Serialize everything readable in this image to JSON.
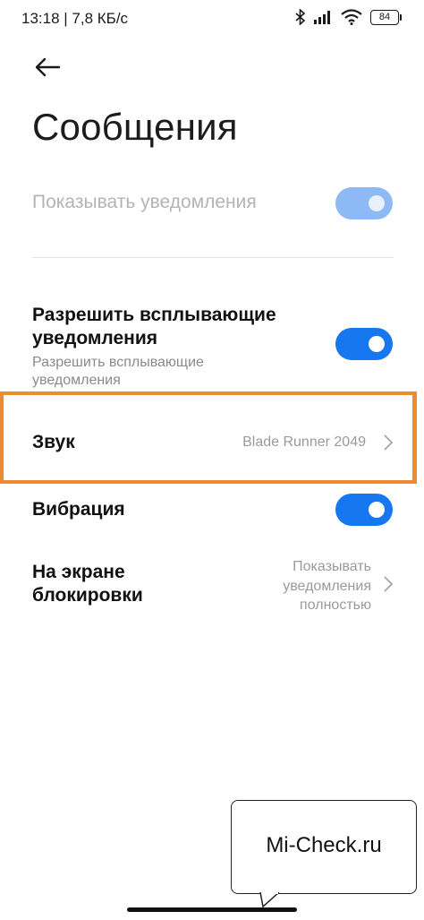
{
  "status_bar": {
    "time_speed": "13:18 | 7,8 КБ/с",
    "battery": "84"
  },
  "header": {
    "title": "Сообщения"
  },
  "settings": {
    "show_notifications": {
      "label": "Показывать уведомления",
      "enabled": true,
      "disabled_state": true
    },
    "popup_notifications": {
      "title_line1": "Разрешить всплывающие",
      "title_line2": "уведомления",
      "subtitle_line1": "Разрешить всплывающие",
      "subtitle_line2": "уведомления",
      "enabled": true
    },
    "sound": {
      "label": "Звук",
      "value": "Blade Runner 2049"
    },
    "vibration": {
      "label": "Вибрация",
      "enabled": true
    },
    "lock_screen": {
      "label_line1": "На экране",
      "label_line2": "блокировки",
      "value_line1": "Показывать",
      "value_line2": "уведомления",
      "value_line3": "полностью"
    }
  },
  "watermark": {
    "text": "Mi-Check.ru"
  },
  "colors": {
    "accent": "#1677f0",
    "highlight": "#f08a30"
  }
}
